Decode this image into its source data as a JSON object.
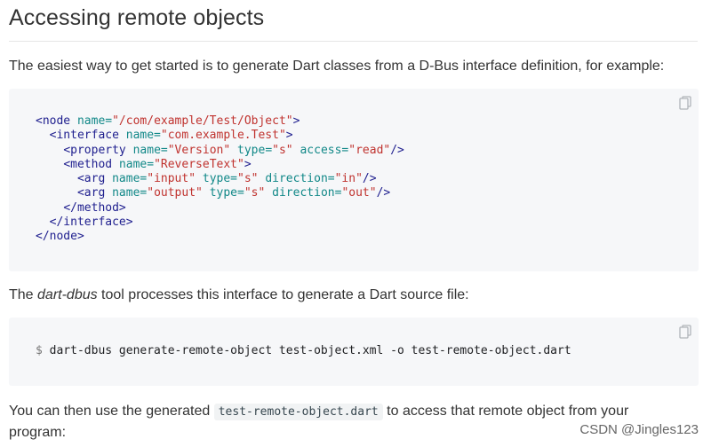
{
  "section": {
    "heading": "Accessing remote objects"
  },
  "intro": {
    "text": "The easiest way to get started is to generate Dart classes from a D-Bus interface definition, for example:"
  },
  "xml_code": {
    "lines": [
      {
        "indent": "",
        "parts": [
          [
            "tag",
            "<node "
          ],
          [
            "attr",
            "name="
          ],
          [
            "val",
            "\"/com/example/Test/Object\""
          ],
          [
            "tag",
            ">"
          ]
        ]
      },
      {
        "indent": "  ",
        "parts": [
          [
            "tag",
            "<interface "
          ],
          [
            "attr",
            "name="
          ],
          [
            "val",
            "\"com.example.Test\""
          ],
          [
            "tag",
            ">"
          ]
        ]
      },
      {
        "indent": "    ",
        "parts": [
          [
            "tag",
            "<property "
          ],
          [
            "attr",
            "name="
          ],
          [
            "val",
            "\"Version\""
          ],
          [
            "plain",
            " "
          ],
          [
            "attr",
            "type="
          ],
          [
            "val",
            "\"s\""
          ],
          [
            "plain",
            " "
          ],
          [
            "attr",
            "access="
          ],
          [
            "val",
            "\"read\""
          ],
          [
            "tag",
            "/>"
          ]
        ]
      },
      {
        "indent": "    ",
        "parts": [
          [
            "tag",
            "<method "
          ],
          [
            "attr",
            "name="
          ],
          [
            "val",
            "\"ReverseText\""
          ],
          [
            "tag",
            ">"
          ]
        ]
      },
      {
        "indent": "      ",
        "parts": [
          [
            "tag",
            "<arg "
          ],
          [
            "attr",
            "name="
          ],
          [
            "val",
            "\"input\""
          ],
          [
            "plain",
            " "
          ],
          [
            "attr",
            "type="
          ],
          [
            "val",
            "\"s\""
          ],
          [
            "plain",
            " "
          ],
          [
            "attr",
            "direction="
          ],
          [
            "val",
            "\"in\""
          ],
          [
            "tag",
            "/>"
          ]
        ]
      },
      {
        "indent": "      ",
        "parts": [
          [
            "tag",
            "<arg "
          ],
          [
            "attr",
            "name="
          ],
          [
            "val",
            "\"output\""
          ],
          [
            "plain",
            " "
          ],
          [
            "attr",
            "type="
          ],
          [
            "val",
            "\"s\""
          ],
          [
            "plain",
            " "
          ],
          [
            "attr",
            "direction="
          ],
          [
            "val",
            "\"out\""
          ],
          [
            "tag",
            "/>"
          ]
        ]
      },
      {
        "indent": "    ",
        "parts": [
          [
            "tag",
            "</method>"
          ]
        ]
      },
      {
        "indent": "  ",
        "parts": [
          [
            "tag",
            "</interface>"
          ]
        ]
      },
      {
        "indent": "",
        "parts": [
          [
            "tag",
            "</node>"
          ]
        ]
      }
    ]
  },
  "tool_para": {
    "prefix": "The ",
    "tool": "dart-dbus",
    "suffix": " tool processes this interface to generate a Dart source file:"
  },
  "shell_code": {
    "prompt": "$",
    "command": "dart-dbus generate-remote-object test-object.xml -o test-remote-object.dart"
  },
  "usage_para": {
    "prefix": "You can then use the generated ",
    "inline_code": "test-remote-object.dart",
    "suffix": " to access that remote object from your",
    "line2": "program:"
  },
  "watermark": {
    "text": "CSDN @Jingles123"
  },
  "icons": {
    "copy": "copy-icon"
  },
  "colors": {
    "tag": "#20208f",
    "attr": "#118888",
    "value": "#c0332f",
    "code_bg": "#f6f7f9"
  }
}
